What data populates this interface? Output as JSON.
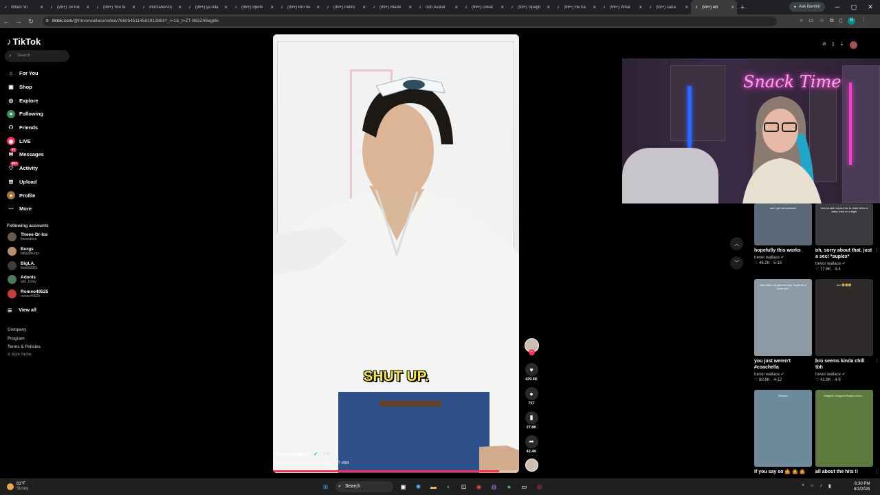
{
  "browser": {
    "tabs": [
      {
        "title": "When Yo",
        "icon": "tiktok-icon"
      },
      {
        "title": "(99+) TikTok",
        "icon": "tiktok-icon"
      },
      {
        "title": "(99+) You fe",
        "icon": "tiktok-icon"
      },
      {
        "title": "#forzahorizo",
        "icon": "tiktok-icon"
      },
      {
        "title": "(99+) ya Alla",
        "icon": "tiktok-icon"
      },
      {
        "title": "(99+) Spotti",
        "icon": "tiktok-icon"
      },
      {
        "title": "(99+) Bro he",
        "icon": "tiktok-icon"
      },
      {
        "title": "(99+) Paltro",
        "icon": "tiktok-icon"
      },
      {
        "title": "(99+) Blade",
        "icon": "tiktok-icon"
      },
      {
        "title": "Iroh Avatar",
        "icon": "tiktok-icon"
      },
      {
        "title": "(99+) Great",
        "icon": "tiktok-icon"
      },
      {
        "title": "(99+) Spagh",
        "icon": "tiktok-icon"
      },
      {
        "title": "(99+) He ha",
        "icon": "tiktok-icon"
      },
      {
        "title": "(99+) What",
        "icon": "tiktok-icon"
      },
      {
        "title": "(99+) sana",
        "icon": "tiktok-icon"
      },
      {
        "title": "(99+) wh",
        "icon": "tiktok-icon"
      }
    ],
    "active_tab_index": 15,
    "new_tab": "+",
    "gemini_label": "Ask Gemini",
    "url_host": "tiktok.com",
    "url_path": "/@trevorwallace/video/7660545114581912863?_r=1&_t=ZT-983ZR6iqp6k",
    "profile_initial": "N"
  },
  "sidebar": {
    "brand": "TikTok",
    "search_placeholder": "Search",
    "nav": [
      {
        "label": "For You",
        "icon": "home-icon",
        "glyph": "⌂"
      },
      {
        "label": "Shop",
        "icon": "shop-icon",
        "glyph": "▣"
      },
      {
        "label": "Explore",
        "icon": "compass-icon",
        "glyph": "◎"
      },
      {
        "label": "Following",
        "icon": "following-icon",
        "glyph": "●"
      },
      {
        "label": "Friends",
        "icon": "friends-icon",
        "glyph": "⚇"
      },
      {
        "label": "LIVE",
        "icon": "live-icon",
        "glyph": "◉"
      },
      {
        "label": "Messages",
        "icon": "messages-icon",
        "glyph": "✉",
        "badge": "17"
      },
      {
        "label": "Activity",
        "icon": "activity-icon",
        "glyph": "♡",
        "badge": "99+"
      },
      {
        "label": "Upload",
        "icon": "upload-icon",
        "glyph": "⊞"
      },
      {
        "label": "Profile",
        "icon": "profile-icon",
        "glyph": "●"
      },
      {
        "label": "More",
        "icon": "more-icon",
        "glyph": "⋯"
      }
    ],
    "following_heading": "Following accounts",
    "accounts": [
      {
        "name": "Theee-Dr-Ice",
        "handle": "theeedrice"
      },
      {
        "name": "Burgs",
        "handle": "tallguyburgz"
      },
      {
        "name": "BigLA.",
        "handle": "thekid2891"
      },
      {
        "name": "Adonis",
        "handle": "a3o_k1tsy"
      },
      {
        "name": "Romeo49525",
        "handle": "romeo49525"
      }
    ],
    "view_all": "View all",
    "footer": [
      "Company",
      "Program",
      "Terms & Policies"
    ],
    "copyright": "© 2026 TikTok"
  },
  "video": {
    "caption_overlay": "SHUT UP.",
    "author": "trevor wallace",
    "date": "· 7-9",
    "description": "what the hell is a turn signal ??? #tbt",
    "progress": 0.92,
    "likes": "429.6K",
    "comments": "757",
    "saves": "27.8K",
    "shares": "42.4K"
  },
  "stream_overlay": {
    "neon_text": "Snack Time"
  },
  "recommendations": [
    {
      "title": "hopefully this works",
      "author": "trevor wallace",
      "likes": "46.2K",
      "date": "5-15",
      "thumb_text": "can i get via windows",
      "bg": "#5b6a78"
    },
    {
      "title": "oh, sorry about that. just a sec! *suplex*",
      "author": "trevor wallace",
      "likes": "77.5K",
      "date": "4-4",
      "thumb_text": "how people expect me to react when a baby cries on a flight",
      "bg": "#3b3a3f"
    },
    {
      "title": "you just weren't #coachella",
      "author": "trevor wallace",
      "likes": "80.8K",
      "date": "4-12",
      "thumb_text": "hate when my parents say \"boyle fra a done this\"",
      "bg": "#8d9aa5"
    },
    {
      "title": "bro seems kinda chill tbh",
      "author": "trevor wallace",
      "likes": "41.9K",
      "date": "4-9",
      "thumb_text": "bro 😂😂😂",
      "bg": "#2f2a2a"
    },
    {
      "title": "If you say so 🤷 🤷 🤷",
      "author": "trevor wallace",
      "likes": "",
      "date": "",
      "thumb_text": "Elwood",
      "bg": "#6d8a9a"
    },
    {
      "title": "all about the hits !!",
      "author": "trevor wallace",
      "likes": "",
      "date": "",
      "thumb_text": "Imagine Chappell Roan's mom ...",
      "bg": "#5c7a3e"
    }
  ],
  "taskbar": {
    "temp": "81°F",
    "condition": "Sunny",
    "search": "Search",
    "time": "6:30 PM",
    "date": "8/3/2026"
  },
  "colors": {
    "accent": "#fe2c55",
    "caption": "#f5e642",
    "verified": "#20d5ec"
  }
}
